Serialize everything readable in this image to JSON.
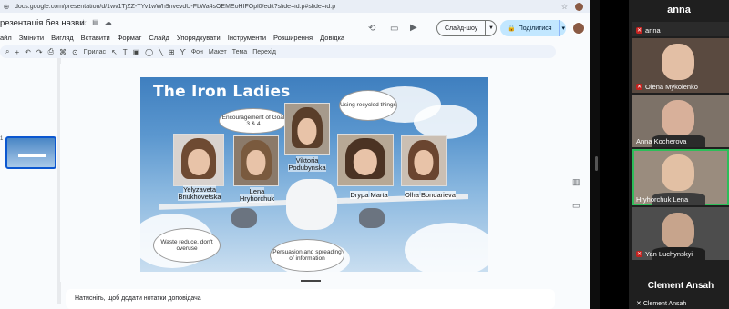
{
  "browser": {
    "url": "docs.google.com/presentation/d/1wv1TjZZ-TYv1wWh9nvevdU-FLWa4sOEMEoHIFOpl0/edit?slide=id.p#slide=id.p"
  },
  "doc": {
    "title": "резентація без назви",
    "menu": [
      "айл",
      "Змінити",
      "Вигляд",
      "Вставити",
      "Формат",
      "Слайд",
      "Упорядкувати",
      "Інструменти",
      "Розширення",
      "Довідка"
    ],
    "slideshow_label": "Слайд-шоу",
    "share_label": "Поділитися"
  },
  "toolbar": {
    "zoom_label": "Прилас",
    "bg_label": "Фон",
    "layout_label": "Макет",
    "theme_label": "Тема",
    "transition_label": "Перехід"
  },
  "filmstrip": {
    "slide_number": "1"
  },
  "slide": {
    "title": "The Iron Ladies",
    "bubbles": {
      "goals": "Encouragement of Goal 3 & 4",
      "recycled": "Using recycled things",
      "waste": "Waste reduce, don't overuse",
      "persuasion": "Persuasion and spreading of information"
    },
    "people": [
      {
        "first": "Yelyzaveta",
        "last": "Briukhovetska"
      },
      {
        "first": "Lena",
        "last": "Hryhorchuk"
      },
      {
        "first": "Viktoria",
        "last": "Podubynska"
      },
      {
        "first": "Drypa",
        "last": "Marta"
      },
      {
        "first": "Olha",
        "last": "Bondarieva"
      }
    ]
  },
  "notes": {
    "placeholder": "Натисніть, щоб додати нотатки доповідача"
  },
  "meeting": {
    "header_name": "anna",
    "participants": [
      {
        "name": "anna"
      },
      {
        "name": "Olena Mykolenko"
      },
      {
        "name": "Anna Kocherova"
      },
      {
        "name": "Hryhorchuk Lena"
      },
      {
        "name": "Yan Luchynskyi"
      }
    ],
    "big_name": "Clement Ansah",
    "bottom_name": "Clement Ansah"
  }
}
